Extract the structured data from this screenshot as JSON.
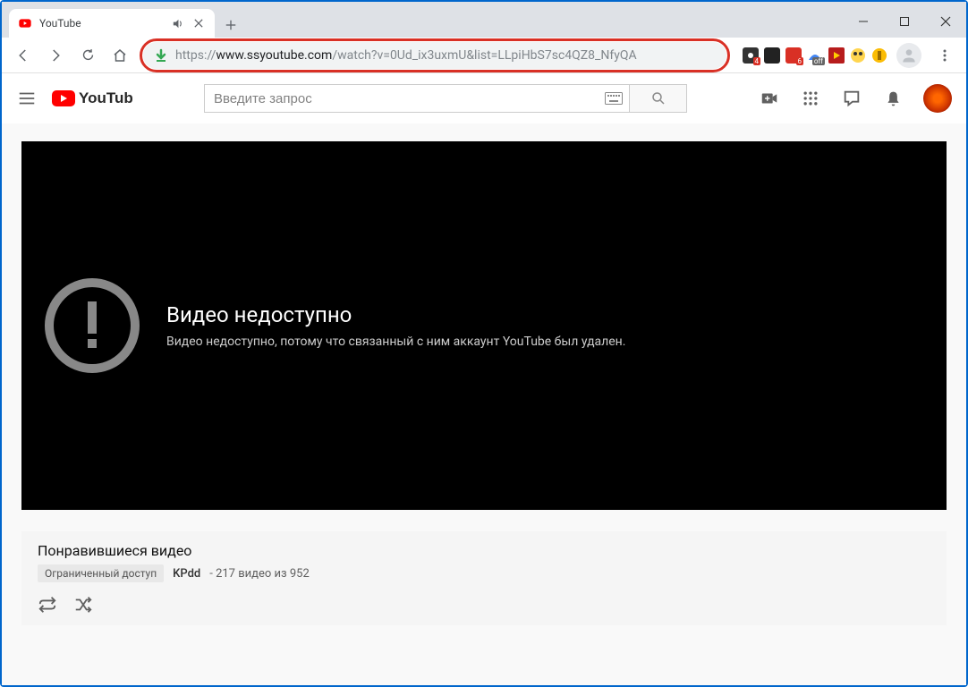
{
  "window": {
    "minimize": "min",
    "maximize": "max",
    "close": "close"
  },
  "tab": {
    "title": "YouTube",
    "audio": true
  },
  "url": {
    "scheme": "https://",
    "prefix": "www.ss",
    "host": "youtube.com",
    "path": "/watch?v=0Ud_ix3uxmU&list=LLpiHbS7sc4QZ8_NfyQA"
  },
  "extensions": {
    "badge1": "4",
    "badge2": "6",
    "badge3": "off"
  },
  "yt": {
    "search_placeholder": "Введите запрос",
    "logo_text": "YouTube"
  },
  "video_error": {
    "title": "Видео недоступно",
    "subtitle": "Видео недоступно, потому что связанный с ним аккаунт YouTube был удален."
  },
  "playlist": {
    "title": "Понравившиеся видео",
    "privacy": "Ограниченный доступ",
    "author": "KPdd",
    "count": "- 217 видео из 952"
  }
}
